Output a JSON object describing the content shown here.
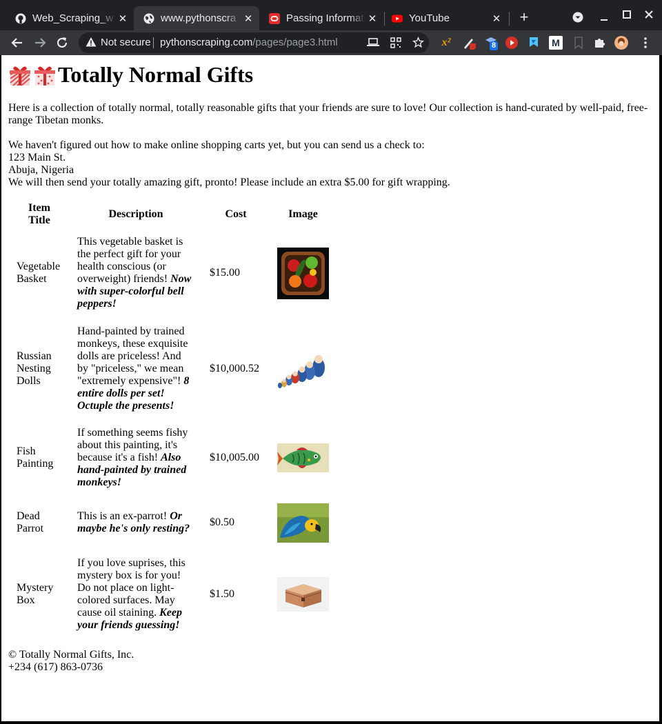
{
  "browser": {
    "tabs": [
      {
        "title": "Web_Scraping_w",
        "icon": "github-icon",
        "active": false
      },
      {
        "title": "www.pythonscra",
        "icon": "globe-icon",
        "active": true
      },
      {
        "title": "Passing Informat",
        "icon": "oracle-icon",
        "active": false
      },
      {
        "title": "YouTube",
        "icon": "youtube-icon",
        "active": false
      }
    ],
    "close_glyph": "✕",
    "new_tab_glyph": "+",
    "security_label": "Not secure",
    "url_host": "pythonscraping.com",
    "url_path": "/pages/page3.html",
    "extension_badge": "8"
  },
  "page": {
    "title": "Totally Normal Gifts",
    "intro": "Here is a collection of totally normal, totally reasonable gifts that your friends are sure to love! Our collection is hand-curated by well-paid, free-range Tibetan monks.",
    "address_lines": [
      "We haven't figured out how to make online shopping carts yet, but you can send us a check to:",
      "123 Main St.",
      "Abuja, Nigeria",
      "We will then send your totally amazing gift, pronto! Please include an extra $5.00 for gift wrapping."
    ],
    "table": {
      "headers": [
        "Item Title",
        "Description",
        "Cost",
        "Image"
      ],
      "rows": [
        {
          "title": "Vegetable Basket",
          "desc": "This vegetable basket is the perfect gift for your health conscious (or overweight) friends! ",
          "desc_em": "Now with super-colorful bell peppers!",
          "cost": "$15.00",
          "image": "vegetable-basket"
        },
        {
          "title": "Russian Nesting Dolls",
          "desc": "Hand-painted by trained monkeys, these exquisite dolls are priceless! And by \"priceless,\" we mean \"extremely expensive\"! ",
          "desc_em": "8 entire dolls per set! Octuple the presents!",
          "cost": "$10,000.52",
          "image": "nesting-dolls"
        },
        {
          "title": "Fish Painting",
          "desc": "If something seems fishy about this painting, it's because it's a fish! ",
          "desc_em": "Also hand-painted by trained monkeys!",
          "cost": "$10,005.00",
          "image": "fish-painting"
        },
        {
          "title": "Dead Parrot",
          "desc": "This is an ex-parrot! ",
          "desc_em": "Or maybe he's only resting?",
          "cost": "$0.50",
          "image": "parrot"
        },
        {
          "title": "Mystery Box",
          "desc": "If you love suprises, this mystery box is for you! Do not place on light-colored surfaces. May cause oil staining. ",
          "desc_em": "Keep your friends guessing!",
          "cost": "$1.50",
          "image": "mystery-box"
        }
      ]
    },
    "footer": {
      "copyright": "© Totally Normal Gifts, Inc.",
      "phone": "+234 (617) 863-0736"
    }
  }
}
